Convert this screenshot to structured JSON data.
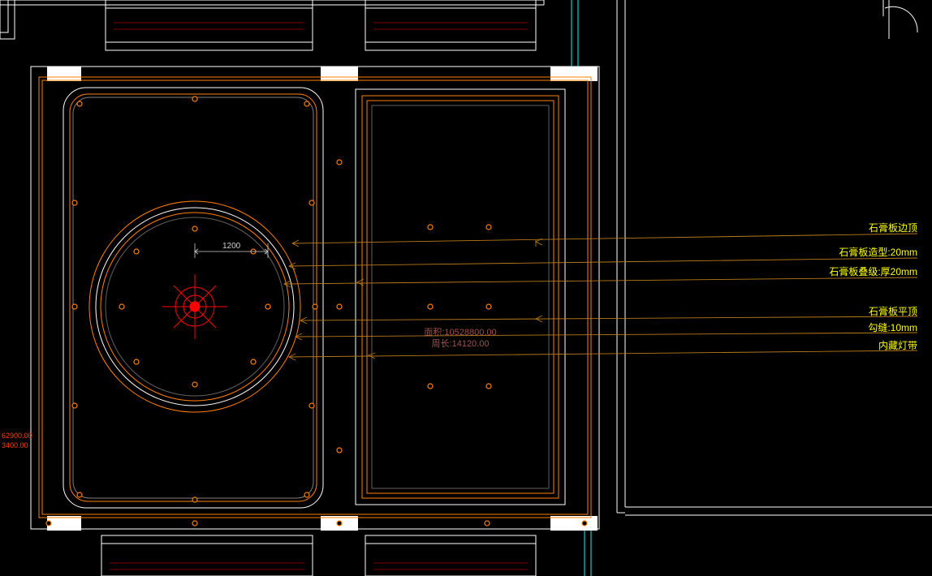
{
  "labels": {
    "l1": "石膏板边顶",
    "l2": "石膏板造型:20mm",
    "l3": "石膏板叠级:厚20mm",
    "l4": "石膏板平顶",
    "l5": "勾缝:10mm",
    "l6": "内藏灯带"
  },
  "dimension": {
    "d1": "1200"
  },
  "area_info": {
    "area_line": "面积:10528800.00",
    "perim_line": "周长:14120.00"
  },
  "side_info": {
    "s1": "62900.00",
    "s2": "3400.00"
  },
  "colors": {
    "white": "#ffffff",
    "red": "#ff0000",
    "orange": "#ff8000",
    "dark_orange": "#cc6600",
    "yellow": "#ffff00",
    "cyan": "#00ffff",
    "rose": "#a05050"
  }
}
